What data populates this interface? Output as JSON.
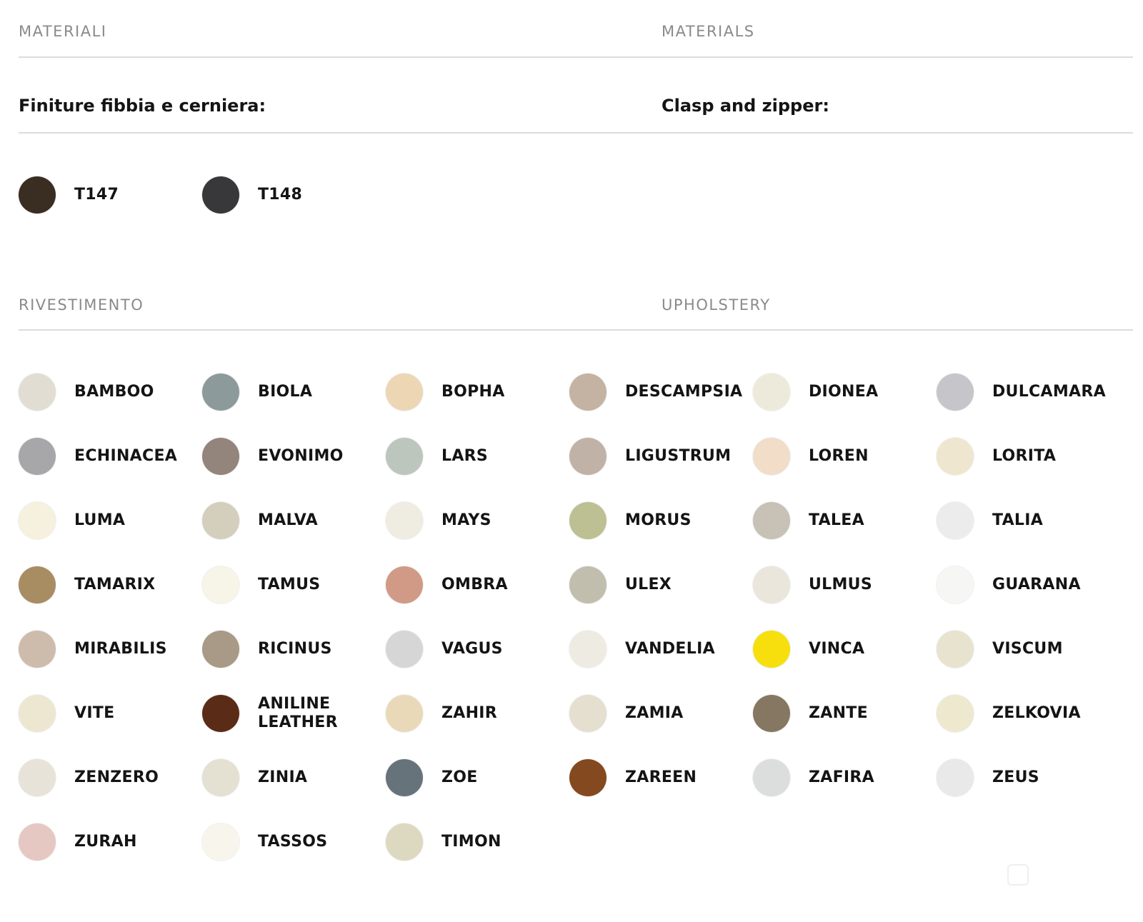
{
  "materials": {
    "title_it": "MATERIALI",
    "title_en": "MATERIALS",
    "clasp_it": "Finiture fibbia e cerniera:",
    "clasp_en": "Clasp and zipper:",
    "finishes": [
      {
        "code": "T147",
        "color": "#3a2e22"
      },
      {
        "code": "T148",
        "color": "#38383a"
      }
    ]
  },
  "upholstery": {
    "title_it": "RIVESTIMENTO",
    "title_en": "UPHOLSTERY",
    "swatches": [
      {
        "name": "BAMBOO",
        "color": "#e2ddd2"
      },
      {
        "name": "BIOLA",
        "color": "#8d9a9c"
      },
      {
        "name": "BOPHA",
        "color": "#ecd6b4"
      },
      {
        "name": "DESCAMPSIA",
        "color": "#c4b2a2"
      },
      {
        "name": "DIONEA",
        "color": "#eeeadb"
      },
      {
        "name": "DULCAMARA",
        "color": "#c6c6ca"
      },
      {
        "name": "ECHINACEA",
        "color": "#a7a7a9"
      },
      {
        "name": "EVONIMO",
        "color": "#93847c"
      },
      {
        "name": "LARS",
        "color": "#bcc6bd"
      },
      {
        "name": "LIGUSTRUM",
        "color": "#c1b2a8"
      },
      {
        "name": "LOREN",
        "color": "#f1ddc8"
      },
      {
        "name": "LORITA",
        "color": "#eee6ce"
      },
      {
        "name": "LUMA",
        "color": "#f6f0de"
      },
      {
        "name": "MALVA",
        "color": "#d4cebc"
      },
      {
        "name": "MAYS",
        "color": "#efece2"
      },
      {
        "name": "MORUS",
        "color": "#bcc093"
      },
      {
        "name": "TALEA",
        "color": "#c8c1b6"
      },
      {
        "name": "TALIA",
        "color": "#ececec"
      },
      {
        "name": "TAMARIX",
        "color": "#a88c62"
      },
      {
        "name": "TAMUS",
        "color": "#f7f4e8"
      },
      {
        "name": "OMBRA",
        "color": "#d19a86"
      },
      {
        "name": "ULEX",
        "color": "#c2beae"
      },
      {
        "name": "ULMUS",
        "color": "#ebe6dc"
      },
      {
        "name": "GUARANA",
        "color": "#f6f6f4"
      },
      {
        "name": "MIRABILIS",
        "color": "#cdbcac"
      },
      {
        "name": "RICINUS",
        "color": "#a89a86"
      },
      {
        "name": "VAGUS",
        "color": "#d6d6d6"
      },
      {
        "name": "VANDELIA",
        "color": "#eeebe2"
      },
      {
        "name": "VINCA",
        "color": "#f7df0e"
      },
      {
        "name": "VISCUM",
        "color": "#e8e3cf"
      },
      {
        "name": "VITE",
        "color": "#ede7d1"
      },
      {
        "name": "ANILINE\nLEATHER",
        "color": "#5a2c18"
      },
      {
        "name": "ZAHIR",
        "color": "#ead9b8"
      },
      {
        "name": "ZAMIA",
        "color": "#e5dfcf"
      },
      {
        "name": "ZANTE",
        "color": "#857762"
      },
      {
        "name": "ZELKOVIA",
        "color": "#eee8cf"
      },
      {
        "name": "ZENZERO",
        "color": "#e7e3d8"
      },
      {
        "name": "ZINIA",
        "color": "#e4e0d2"
      },
      {
        "name": "ZOE",
        "color": "#67737b"
      },
      {
        "name": "ZAREEN",
        "color": "#84491e"
      },
      {
        "name": "ZAFIRA",
        "color": "#dcdddd"
      },
      {
        "name": "ZEUS",
        "color": "#e9e9e9"
      },
      {
        "name": "ZURAH",
        "color": "#e6c8c2"
      },
      {
        "name": "TASSOS",
        "color": "#f8f5ec"
      },
      {
        "name": "TIMON",
        "color": "#ddd8c0"
      }
    ]
  }
}
